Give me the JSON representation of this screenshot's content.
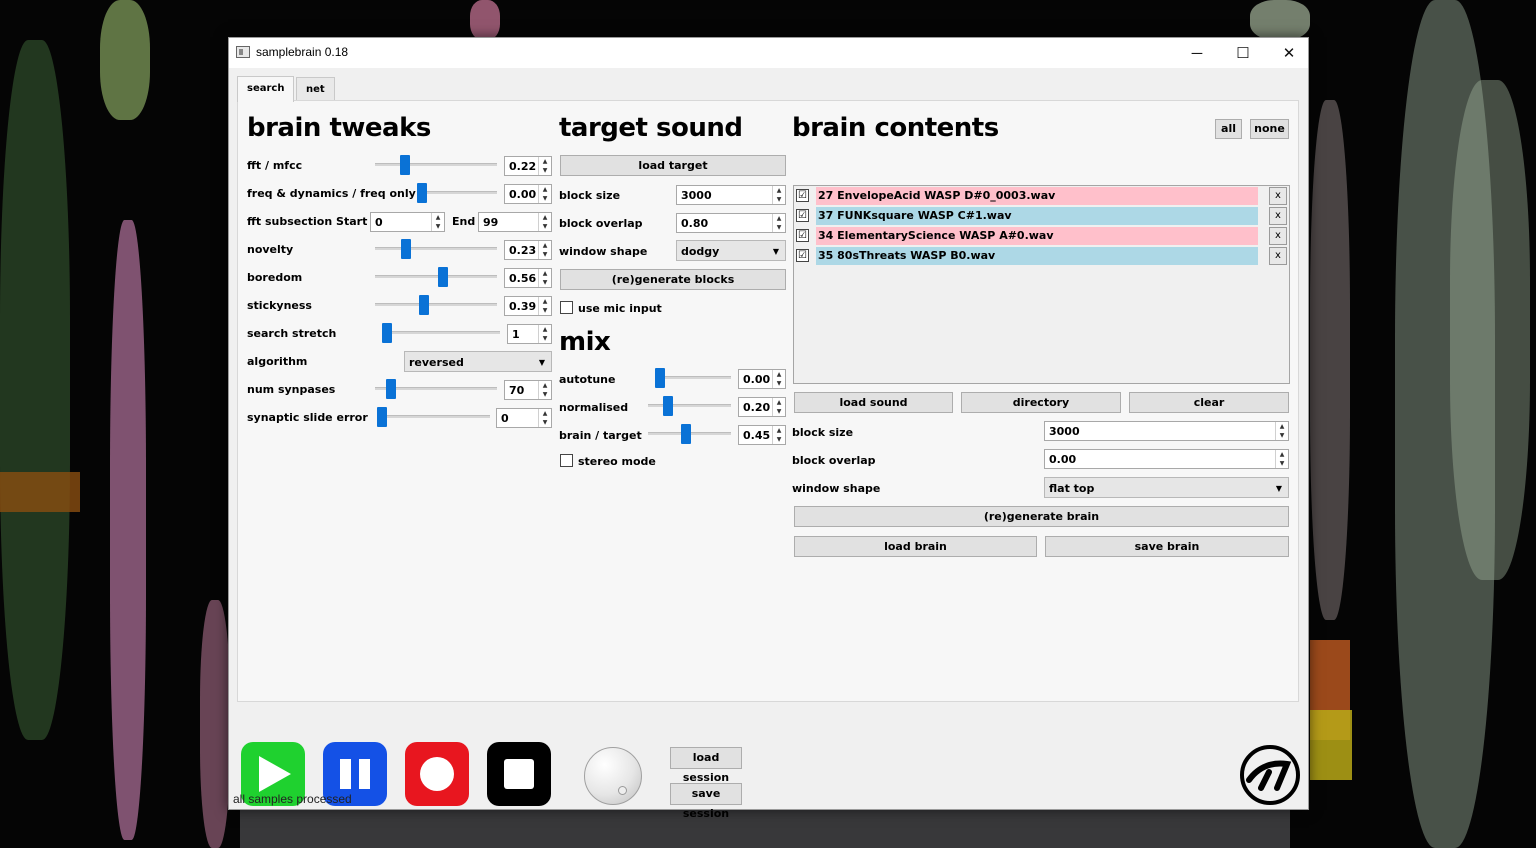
{
  "window": {
    "title": "samplebrain 0.18"
  },
  "tabs": [
    "search",
    "net"
  ],
  "brain_tweaks": {
    "heading": "brain tweaks",
    "fft_mfcc": {
      "label": "fft / mfcc",
      "value": "0.22",
      "level": 0.22
    },
    "freq_dynamics": {
      "label": "freq & dynamics / freq only",
      "value": "0.00",
      "level": 0.0
    },
    "fft_subsection": {
      "label": "fft subsection",
      "start_label": "Start",
      "start": "0",
      "end_label": "End",
      "end": "99"
    },
    "novelty": {
      "label": "novelty",
      "value": "0.23",
      "level": 0.23
    },
    "boredom": {
      "label": "boredom",
      "value": "0.56",
      "level": 0.56
    },
    "stickyness": {
      "label": "stickyness",
      "value": "0.39",
      "level": 0.39
    },
    "search_stretch": {
      "label": "search stretch",
      "value": "1",
      "level": 0.0
    },
    "algorithm": {
      "label": "algorithm",
      "value": "reversed"
    },
    "num_synapses": {
      "label": "num synpases",
      "value": "70",
      "level": 0.1
    },
    "synaptic_slide_error": {
      "label": "synaptic slide error",
      "value": "0",
      "level": 0.0
    }
  },
  "target_sound": {
    "heading": "target sound",
    "load_target": "load target",
    "block_size": {
      "label": "block size",
      "value": "3000"
    },
    "block_overlap": {
      "label": "block overlap",
      "value": "0.80"
    },
    "window_shape": {
      "label": "window shape",
      "value": "dodgy"
    },
    "regenerate_blocks": "(re)generate blocks",
    "use_mic_input": "use mic input"
  },
  "mix": {
    "heading": "mix",
    "autotune": {
      "label": "autotune",
      "value": "0.00",
      "level": 0.0
    },
    "normalised": {
      "label": "normalised",
      "value": "0.20",
      "level": 0.2
    },
    "brain_target": {
      "label": "brain / target",
      "value": "0.45",
      "level": 0.45
    },
    "stereo_mode": "stereo mode"
  },
  "brain_contents": {
    "heading": "brain contents",
    "all_label": "all",
    "none_label": "none",
    "samples": [
      {
        "name": "27 EnvelopeAcid WASP D#0_0003.wav",
        "checked": "☑",
        "color": "#ffc0cb"
      },
      {
        "name": "37 FUNKsquare WASP C#1.wav",
        "checked": "☑",
        "color": "#add8e6"
      },
      {
        "name": "34 ElementaryScience WASP A#0.wav",
        "checked": "☑",
        "color": "#ffc0cb"
      },
      {
        "name": "35 80sThreats WASP B0.wav",
        "checked": "☑",
        "color": "#add8e6"
      }
    ],
    "remove_label": "x",
    "load_sound": "load sound",
    "directory": "directory",
    "clear": "clear",
    "block_size": {
      "label": "block size",
      "value": "3000"
    },
    "block_overlap": {
      "label": "block overlap",
      "value": "0.00"
    },
    "window_shape": {
      "label": "window shape",
      "value": "flat top"
    },
    "regenerate_brain": "(re)generate brain",
    "load_brain": "load brain",
    "save_brain": "save brain"
  },
  "transport": {
    "play_color": "#1fd12f",
    "pause_color": "#1451e6",
    "record_color": "#e8161f",
    "stop_color": "#000000",
    "load_session": "load session",
    "save_session": "save session"
  },
  "status": "all samples processed"
}
